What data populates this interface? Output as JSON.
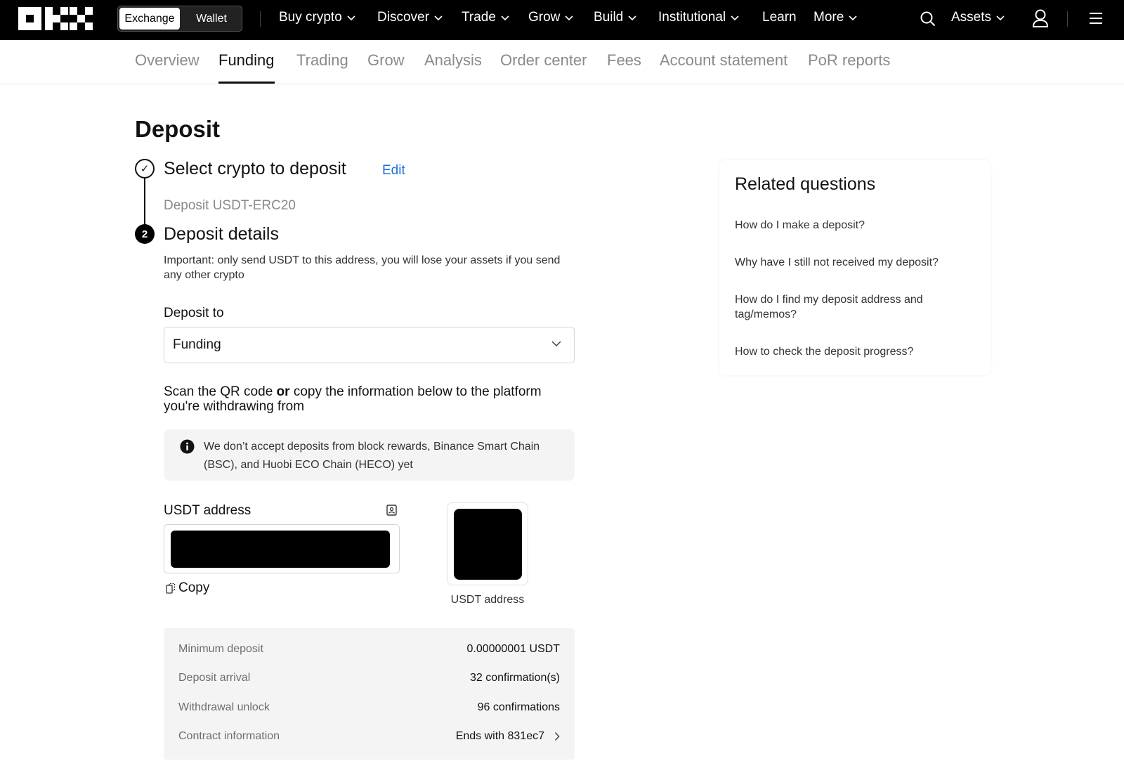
{
  "header": {
    "logo_text": "OKX",
    "mode_toggle": [
      "Exchange",
      "Wallet"
    ],
    "nav": [
      {
        "label": "Buy crypto",
        "dropdown": true
      },
      {
        "label": "Discover",
        "dropdown": true
      },
      {
        "label": "Trade",
        "dropdown": true
      },
      {
        "label": "Grow",
        "dropdown": true
      },
      {
        "label": "Build",
        "dropdown": true
      },
      {
        "label": "Institutional",
        "dropdown": true
      },
      {
        "label": "Learn",
        "dropdown": false
      },
      {
        "label": "More",
        "dropdown": true
      }
    ],
    "assets_label": "Assets",
    "icons": [
      "search-icon",
      "user-icon",
      "menu-icon"
    ]
  },
  "subtabs": {
    "items": [
      "Overview",
      "Funding",
      "Trading",
      "Grow",
      "Analysis",
      "Order center",
      "Fees",
      "Account statement",
      "PoR reports"
    ],
    "active": "Funding"
  },
  "deposit": {
    "page_title": "Deposit",
    "step1": {
      "number": "✓",
      "title": "Select crypto to deposit",
      "edit_label": "Edit",
      "selection": "Deposit USDT-ERC20"
    },
    "step2": {
      "number": "2",
      "title": "Deposit details",
      "warning": "Important: only send USDT to this address, you will lose your assets if you send any other crypto"
    },
    "deposit_to": {
      "label": "Deposit to",
      "value": "Funding"
    },
    "scan_text": {
      "before": "Scan the QR code ",
      "bold": "or",
      "after": " copy the information below to the platform you're withdrawing from"
    },
    "notice": "We don’t accept deposits from block rewards, Binance Smart Chain (BSC), and Huobi ECO Chain (HECO) yet",
    "address": {
      "label": "USDT address",
      "copy_label": "Copy",
      "qr_caption": "USDT address"
    },
    "info": [
      {
        "key": "Minimum deposit",
        "value": "0.00000001 USDT"
      },
      {
        "key": "Deposit arrival",
        "value": "32 confirmation(s)"
      },
      {
        "key": "Withdrawal unlock",
        "value": "96 confirmations"
      },
      {
        "key": "Contract information",
        "value": "Ends with 831ec7"
      }
    ]
  },
  "related": {
    "title": "Related questions",
    "questions": [
      "How do I make a deposit?",
      "Why have I still not received my deposit?",
      "How do I find my deposit address and tag/memos?",
      "How to check the deposit progress?"
    ]
  },
  "colors": {
    "accent_link": "#1e6fd9",
    "header_bg": "#000000",
    "panel_bg": "#f4f4f4"
  }
}
